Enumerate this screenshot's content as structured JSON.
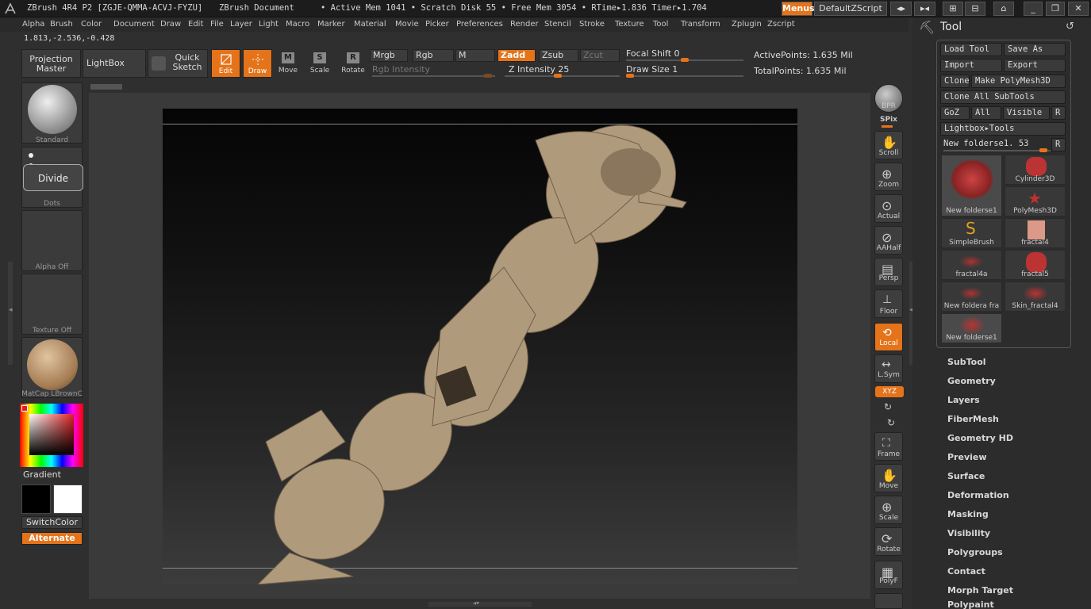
{
  "title": {
    "app": "ZBrush 4R4 P2 [ZGJE-QMMA-ACVJ-FYZU]",
    "document": "ZBrush Document",
    "status": "• Active Mem 1041 • Scratch Disk 55 • Free Mem 3054 • RTime▸1.836 Timer▸1.704",
    "menus_btn": "Menus",
    "script_btn": "DefaultZScript"
  },
  "menus": [
    "Alpha",
    "Brush",
    "Color",
    "Document",
    "Draw",
    "Edit",
    "File",
    "Layer",
    "Light",
    "Macro",
    "Marker",
    "Material",
    "Movie",
    "Picker",
    "Preferences",
    "Render",
    "Stencil",
    "Stroke",
    "Texture",
    "Tool",
    "Transform",
    "Zplugin",
    "Zscript"
  ],
  "coords": "1.813,-2.536,-0.428",
  "toolbar": {
    "projection_master": "Projection Master",
    "lightbox": "LightBox",
    "quick_sketch": "Quick Sketch",
    "edit": "Edit",
    "draw": "Draw",
    "move": "Move",
    "scale": "Scale",
    "rotate": "Rotate",
    "mrgb": "Mrgb",
    "rgb": "Rgb",
    "m": "M",
    "zadd": "Zadd",
    "zsub": "Zsub",
    "zcut": "Zcut",
    "rgb_intensity": "Rgb Intensity",
    "z_intensity": "Z Intensity 25",
    "focal_shift": "Focal Shift 0",
    "draw_size": "Draw Size 1",
    "active_points": "ActivePoints: 1.635 Mil",
    "total_points": "TotalPoints: 1.635 Mil",
    "z_intensity_value": 25,
    "focal_shift_value": 0,
    "draw_size_value": 1
  },
  "left_shelf": {
    "brush": "Standard",
    "stroke": "Dots",
    "divide_popup": "Divide",
    "alpha": "Alpha Off",
    "texture": "Texture Off",
    "material": "MatCap LBrownC",
    "gradient": "Gradient",
    "switch_color": "SwitchColor",
    "alternate": "Alternate"
  },
  "right_shelf": [
    {
      "name": "bpr",
      "label": "BPR"
    },
    {
      "name": "spix",
      "label": "SPix"
    },
    {
      "name": "scroll",
      "label": "Scroll"
    },
    {
      "name": "zoom",
      "label": "Zoom"
    },
    {
      "name": "actual",
      "label": "Actual"
    },
    {
      "name": "aahalf",
      "label": "AAHalf"
    },
    {
      "name": "persp",
      "label": "Persp"
    },
    {
      "name": "floor",
      "label": "Floor"
    },
    {
      "name": "local",
      "label": "Local"
    },
    {
      "name": "lsym",
      "label": "L.Sym"
    },
    {
      "name": "xyz",
      "label": "XYZ"
    },
    {
      "name": "frame",
      "label": "Frame"
    },
    {
      "name": "move",
      "label": "Move"
    },
    {
      "name": "scale",
      "label": "Scale"
    },
    {
      "name": "rotate",
      "label": "Rotate"
    },
    {
      "name": "polyf",
      "label": "PolyF"
    }
  ],
  "tool": {
    "title": "Tool",
    "load_tool": "Load Tool",
    "save_as": "Save As",
    "import": "Import",
    "export": "Export",
    "clone": "Clone",
    "make_polymesh": "Make PolyMesh3D",
    "clone_all": "Clone All SubTools",
    "goz": "GoZ",
    "all": "All",
    "visible": "Visible",
    "r": "R",
    "lightbox_tools": "Lightbox▸Tools",
    "current_tool": "New folderse1. 53",
    "thumbs": [
      "New folderse1",
      "Cylinder3D",
      "PolyMesh3D",
      "SimpleBrush",
      "fractal4",
      "fractal4a",
      "fractal5",
      "New foldera fra",
      "Skin_fractal4",
      "New folderse1"
    ],
    "subpalettes": [
      "SubTool",
      "Geometry",
      "Layers",
      "FiberMesh",
      "Geometry HD",
      "Preview",
      "Surface",
      "Deformation",
      "Masking",
      "Visibility",
      "Polygroups",
      "Contact",
      "Morph Target",
      "Polypaint"
    ]
  },
  "colors": {
    "accent": "#e5731a",
    "clay": "#b09a7c"
  }
}
